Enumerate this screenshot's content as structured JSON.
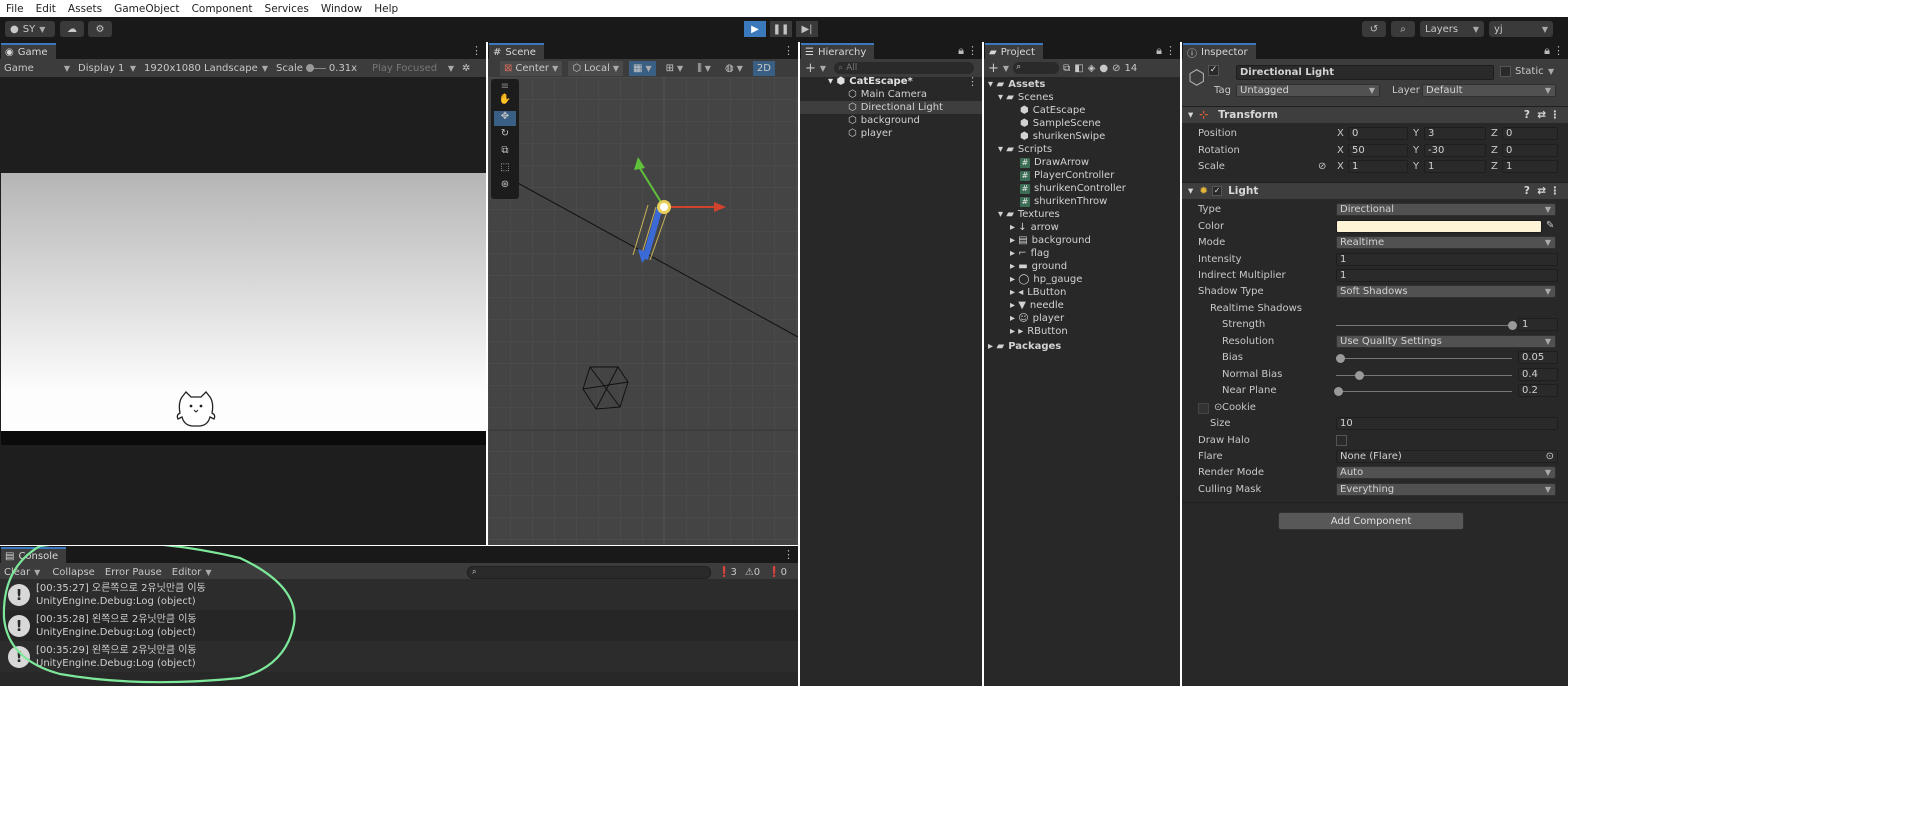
{
  "menu": [
    "File",
    "Edit",
    "Assets",
    "GameObject",
    "Component",
    "Services",
    "Window",
    "Help"
  ],
  "toolbar": {
    "account": "SY",
    "layers_label": "Layers",
    "layout_label": "yj"
  },
  "game": {
    "tab": "Game",
    "display_mode": "Game",
    "display": "Display 1",
    "resolution": "1920x1080 Landscape",
    "scale_label": "Scale",
    "scale_value": "0.31x",
    "play_mode": "Play Focused"
  },
  "scene": {
    "tab": "Scene",
    "pivot": "Center",
    "space": "Local",
    "mode_2d": "2D"
  },
  "hierarchy": {
    "tab": "Hierarchy",
    "search_placeholder": "All",
    "scene_name": "CatEscape*",
    "items": [
      "Main Camera",
      "Directional Light",
      "background",
      "player"
    ]
  },
  "project": {
    "tab": "Project",
    "badge": "14",
    "assets": "Assets",
    "scenes_folder": "Scenes",
    "scenes": [
      "CatEscape",
      "SampleScene",
      "shurikenSwipe"
    ],
    "scripts_folder": "Scripts",
    "scripts": [
      "DrawArrow",
      "PlayerController",
      "shurikenController",
      "shurikenThrow"
    ],
    "textures_folder": "Textures",
    "textures": [
      "arrow",
      "background",
      "flag",
      "ground",
      "hp_gauge",
      "LButton",
      "needle",
      "player",
      "RButton"
    ],
    "packages": "Packages"
  },
  "inspector": {
    "tab": "Inspector",
    "object_name": "Directional Light",
    "static_label": "Static",
    "tag_label": "Tag",
    "tag_value": "Untagged",
    "layer_label": "Layer",
    "layer_value": "Default",
    "transform": {
      "title": "Transform",
      "position_label": "Position",
      "rotation_label": "Rotation",
      "scale_label": "Scale",
      "axis": [
        "X",
        "Y",
        "Z"
      ],
      "position": [
        "0",
        "3",
        "0"
      ],
      "rotation": [
        "50",
        "-30",
        "0"
      ],
      "scale": [
        "1",
        "1",
        "1"
      ]
    },
    "light": {
      "title": "Light",
      "type_label": "Type",
      "type_value": "Directional",
      "color_label": "Color",
      "color_hex": "#fff4d6",
      "mode_label": "Mode",
      "mode_value": "Realtime",
      "intensity_label": "Intensity",
      "intensity_value": "1",
      "indirect_label": "Indirect Multiplier",
      "indirect_value": "1",
      "shadow_type_label": "Shadow Type",
      "shadow_type_value": "Soft Shadows",
      "realtime_shadows_label": "Realtime Shadows",
      "strength_label": "Strength",
      "strength_value": "1",
      "resolution_label": "Resolution",
      "resolution_value": "Use Quality Settings",
      "bias_label": "Bias",
      "bias_value": "0.05",
      "normal_bias_label": "Normal Bias",
      "normal_bias_value": "0.4",
      "near_plane_label": "Near Plane",
      "near_plane_value": "0.2",
      "cookie_label": "Cookie",
      "size_label": "Size",
      "size_value": "10",
      "draw_halo_label": "Draw Halo",
      "flare_label": "Flare",
      "flare_value": "None (Flare)",
      "render_mode_label": "Render Mode",
      "render_mode_value": "Auto",
      "culling_mask_label": "Culling Mask",
      "culling_mask_value": "Everything"
    },
    "add_component": "Add Component"
  },
  "console": {
    "tab": "Console",
    "clear": "Clear",
    "collapse": "Collapse",
    "error_pause": "Error Pause",
    "editor": "Editor",
    "count_log": "3",
    "count_warn": "0",
    "count_err": "0",
    "logs": [
      {
        "line1": "[00:35:27] 오른쪽으로 2유닛만큼 이동",
        "line2": "UnityEngine.Debug:Log (object)"
      },
      {
        "line1": "[00:35:28] 왼쪽으로 2유닛만큼 이동",
        "line2": "UnityEngine.Debug:Log (object)"
      },
      {
        "line1": "[00:35:29] 왼쪽으로 2유닛만큼 이동",
        "line2": "UnityEngine.Debug:Log (object)"
      }
    ]
  },
  "colors": {
    "accent": "#3a79bb",
    "annotation": "#7ee89a",
    "panel_bg": "#282828"
  }
}
